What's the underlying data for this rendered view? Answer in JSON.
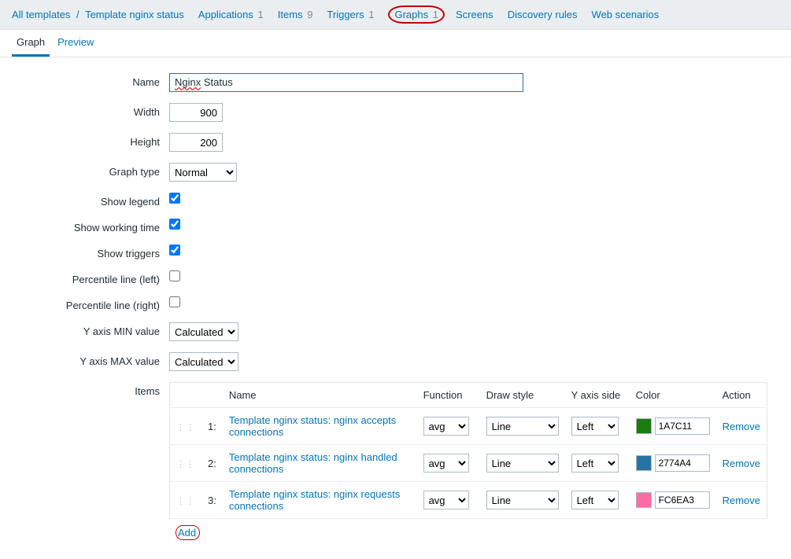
{
  "breadcrumb": {
    "all_templates": "All templates",
    "template_name": "Template nginx status",
    "applications_label": "Applications",
    "applications_count": "1",
    "items_label": "Items",
    "items_count": "9",
    "triggers_label": "Triggers",
    "triggers_count": "1",
    "graphs_label": "Graphs",
    "graphs_count": "1",
    "screens_label": "Screens",
    "discovery_label": "Discovery rules",
    "webscenarios_label": "Web scenarios"
  },
  "tabs": {
    "graph": "Graph",
    "preview": "Preview"
  },
  "form": {
    "labels": {
      "name": "Name",
      "width": "Width",
      "height": "Height",
      "graph_type": "Graph type",
      "show_legend": "Show legend",
      "show_working_time": "Show working time",
      "show_triggers": "Show triggers",
      "percentile_left": "Percentile line (left)",
      "percentile_right": "Percentile line (right)",
      "ymin": "Y axis MIN value",
      "ymax": "Y axis MAX value",
      "items": "Items"
    },
    "values": {
      "name_prefix": "Nginx",
      "name_suffix": " Status",
      "width": "900",
      "height": "200",
      "graph_type": "Normal",
      "ymin": "Calculated",
      "ymax": "Calculated",
      "show_legend": true,
      "show_working_time": true,
      "show_triggers": true,
      "percentile_left": false,
      "percentile_right": false
    }
  },
  "items_table": {
    "headers": {
      "name": "Name",
      "function": "Function",
      "draw_style": "Draw style",
      "yaxis_side": "Y axis side",
      "color": "Color",
      "action": "Action"
    },
    "function_option": "avg",
    "drawstyle_option": "Line",
    "yaxis_option": "Left",
    "remove_label": "Remove",
    "add_label": "Add",
    "rows": [
      {
        "num": "1:",
        "name": "Template nginx status: nginx accepts connections",
        "color_hex": "1A7C11",
        "color_css": "#1A7C11"
      },
      {
        "num": "2:",
        "name": "Template nginx status: nginx handled connections",
        "color_hex": "2774A4",
        "color_css": "#2774A4"
      },
      {
        "num": "3:",
        "name": "Template nginx status: nginx requests connections",
        "color_hex": "FC6EA3",
        "color_css": "#FC6EA3"
      }
    ]
  }
}
